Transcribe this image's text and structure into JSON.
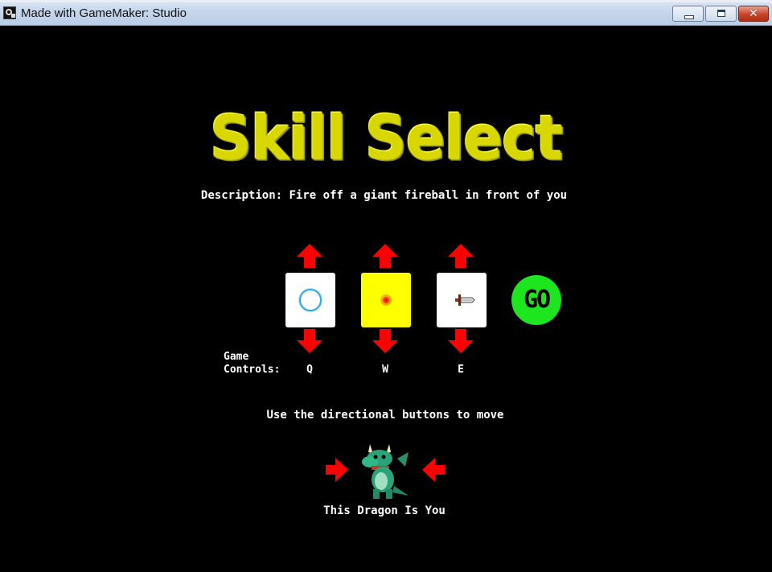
{
  "window": {
    "title": "Made with GameMaker: Studio"
  },
  "colors": {
    "title_yellow": "#d8d800",
    "arrow_red": "#ff0000",
    "go_green": "#1ee61e",
    "slot_active": "#ffff00"
  },
  "screen": {
    "title": "Skill Select",
    "description": "Description: Fire off a giant fireball in front of you",
    "controls_label_line1": "Game",
    "controls_label_line2": "Controls:",
    "skills": [
      {
        "key": "Q",
        "icon": "ice-orb-icon"
      },
      {
        "key": "W",
        "icon": "fireball-icon",
        "selected": true
      },
      {
        "key": "E",
        "icon": "sword-icon"
      }
    ],
    "go_label": "GO",
    "move_hint": "Use the directional buttons to move",
    "player_label": "This Dragon Is You"
  }
}
